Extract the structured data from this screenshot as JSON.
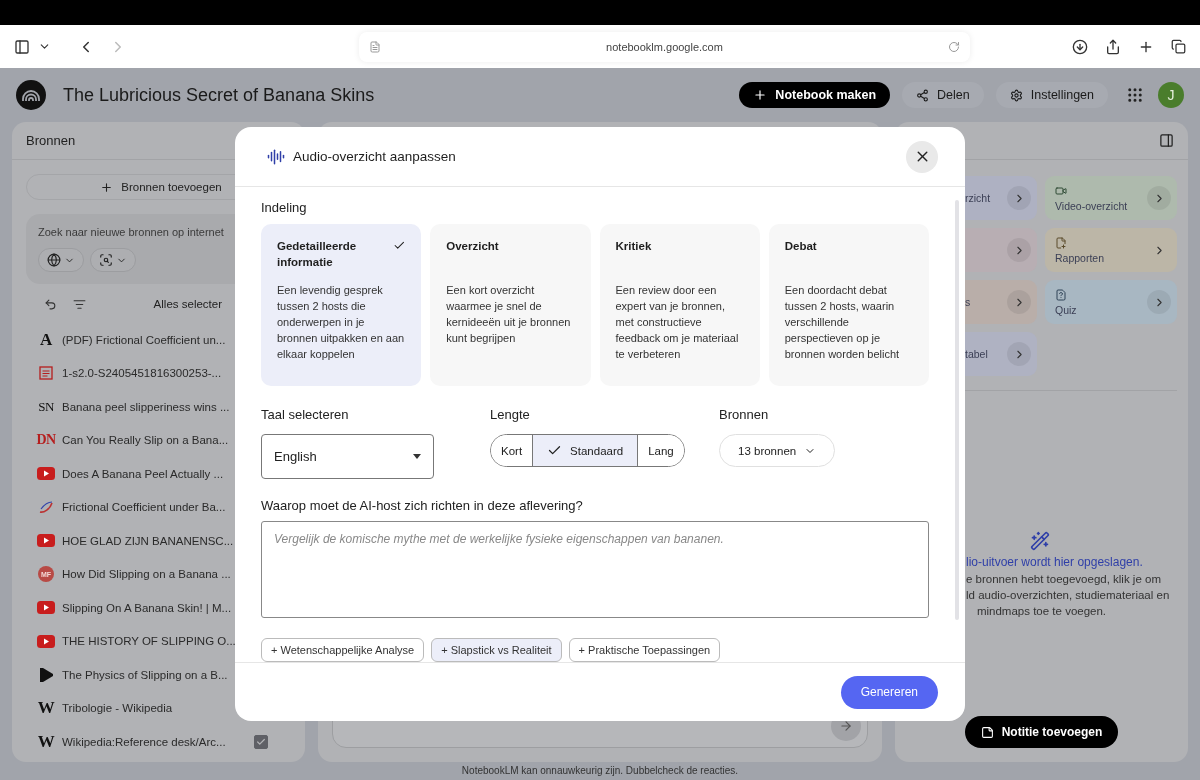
{
  "browser": {
    "url": "notebooklm.google.com",
    "forward_disabled": true
  },
  "header": {
    "title": "The Lubricious Secret of Banana Skins",
    "actions": [
      {
        "kind": "primary",
        "label": "Notebook maken"
      },
      {
        "kind": "share",
        "label": "Delen"
      },
      {
        "kind": "settings",
        "label": "Instellingen"
      }
    ],
    "avatar": "J"
  },
  "sources_panel": {
    "title": "Bronnen",
    "add_label": "Bronnen toevoegen",
    "search_placeholder": "Zoek naar nieuwe bronnen op internet",
    "select_all": "Alles selecter",
    "items": [
      {
        "kind": "letter",
        "icon_text": "A",
        "title": "(PDF) Frictional Coefficient un..."
      },
      {
        "kind": "pdf",
        "title": "1-s2.0-S2405451816300253-..."
      },
      {
        "kind": "letter",
        "icon_text": "SN",
        "title": "Banana peel slipperiness wins ..."
      },
      {
        "kind": "bold",
        "icon_text": "DN",
        "title": "Can You Really Slip on a Bana..."
      },
      {
        "kind": "video",
        "title": "Does A Banana Peel Actually ..."
      },
      {
        "kind": "swirl",
        "title": "Frictional Coefficient under Ba..."
      },
      {
        "kind": "video",
        "title": "HOE GLAD ZIJN BANANENSC..."
      },
      {
        "kind": "badge",
        "icon_text": "MF",
        "title": "How Did Slipping on a Banana ..."
      },
      {
        "kind": "video",
        "title": "Slipping On A Banana Skin! | M..."
      },
      {
        "kind": "video",
        "title": "THE HISTORY OF SLIPPING O..."
      },
      {
        "kind": "wedge",
        "title": "The Physics of Slipping on a B..."
      },
      {
        "kind": "letter",
        "icon_text": "W",
        "title": "Tribologie - Wikipedia"
      },
      {
        "kind": "letter",
        "icon_text": "W",
        "title": "Wikipedia:Reference desk/Arc...",
        "checked": true
      }
    ]
  },
  "studio_panel": {
    "tiles": [
      {
        "kind": "covered",
        "label": "rzicht",
        "color": "#aeb1c2"
      },
      {
        "kind": "video",
        "label": "Video-overzicht",
        "color": "#aebaad"
      },
      {
        "kind": "covered",
        "color": "#b8aeb3"
      },
      {
        "kind": "reports",
        "label": "Rapporten",
        "color": "#bcb6a7"
      },
      {
        "kind": "covered",
        "label": "s",
        "color": "#b9aea9"
      },
      {
        "kind": "quiz",
        "label": "Quiz",
        "color": "#a8b7c2"
      },
      {
        "kind": "covered",
        "label": "tabel",
        "color": "#afb2c2"
      }
    ],
    "empty_title": "lio-uitvoer wordt hier opgeslagen.",
    "empty_lines": [
      "e bronnen hebt toegevoegd, klik je om",
      "ld audio-overzichten, studiemateriaal en",
      "mindmaps toe te voegen."
    ],
    "note_button": "Notitie toevoegen"
  },
  "dialog": {
    "title": "Audio-overzicht aanpassen",
    "format_label": "Indeling",
    "formats": [
      {
        "title": "Gedetailleerde informatie",
        "description": "Een levendig gesprek tussen 2 hosts die onderwerpen in je bronnen uitpakken en aan elkaar koppelen",
        "selected": true
      },
      {
        "title": "Overzicht",
        "description": "Een kort overzicht waarmee je snel de kernideeën uit je bronnen kunt begrijpen",
        "selected": false
      },
      {
        "title": "Kritiek",
        "description": "Een review door een expert van je bronnen, met constructieve feedback om je materiaal te verbeteren",
        "selected": false
      },
      {
        "title": "Debat",
        "description": "Een doordacht debat tussen 2 hosts, waarin verschillende perspectieven op je bronnen worden belicht",
        "selected": false
      }
    ],
    "language": {
      "label": "Taal selecteren",
      "value": "English"
    },
    "length": {
      "label": "Lengte",
      "options": [
        {
          "label": "Kort",
          "selected": false
        },
        {
          "label": "Standaard",
          "selected": true
        },
        {
          "label": "Lang",
          "selected": false
        }
      ]
    },
    "sources": {
      "label": "Bronnen",
      "value": "13 bronnen"
    },
    "prompt": {
      "label": "Waarop moet de AI-host zich richten in deze aflevering?",
      "placeholder": "Vergelijk de komische mythe met de werkelijke fysieke eigenschappen van bananen."
    },
    "suggestions": [
      {
        "label": "+ Wetenschappelijke Analyse",
        "selected": false
      },
      {
        "label": "+ Slapstick vs Realiteit",
        "selected": true
      },
      {
        "label": "+ Praktische Toepassingen",
        "selected": false
      }
    ],
    "generate": "Genereren"
  },
  "footer": "NotebookLM kan onnauwkeurig zijn. Dubbelcheck de reacties."
}
